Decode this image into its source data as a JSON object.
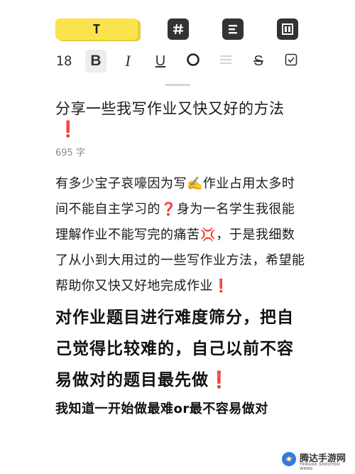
{
  "toolbar": {
    "text_style_label": "T",
    "font_size": "18",
    "bold_label": "B",
    "italic_label": "I",
    "underline_label": "U",
    "strike_label": "S"
  },
  "note": {
    "title": "分享一些我写作业又快又好的方法",
    "title_mark": "❗",
    "word_count": "695 字",
    "para1_a": "有多少宝子哀嚎因为写",
    "para1_icon": "✍️",
    "para1_b": "作业占用太多时间不能自主学习的",
    "para1_q": "❓",
    "para1_c": "身为一名学生我很能理解作业不能写完的痛苦",
    "para1_anger": "💢",
    "para1_d": "，于是我细数了从小到大用过的一些写作业方法，希望能帮助你又快又好地完成作业",
    "para1_excl": "❗",
    "para2_a": "对作业题目进行难度筛分，把自己觉得比较难的，自己以前不容易做对的题目最先做",
    "para2_excl": "❗",
    "para3": "我知道一开始做最难or最不容易做对"
  },
  "watermark": {
    "text": "腾达手游网",
    "sub": "TENGDA SHOUYOU WANG"
  },
  "colors": {
    "accent_yellow": "#fbe34d",
    "emphasis_red": "#d8232a",
    "icon_dark": "#333333"
  }
}
